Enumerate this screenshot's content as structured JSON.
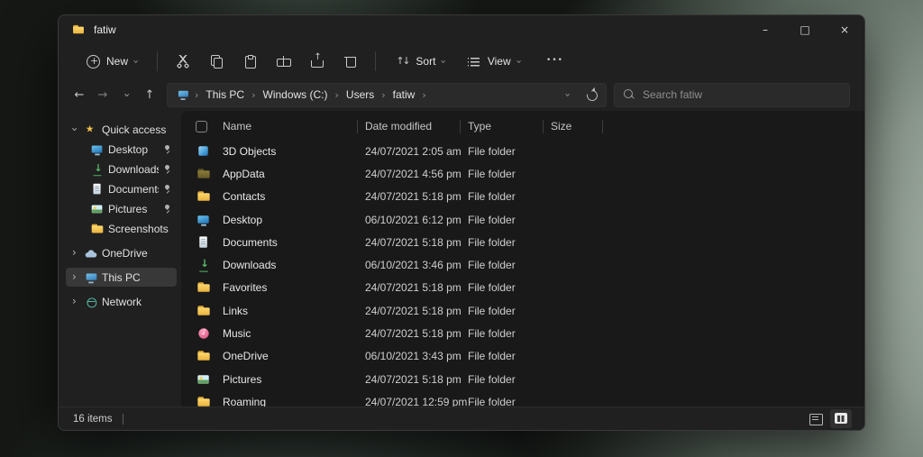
{
  "window": {
    "title": "fatiw",
    "controls": {
      "minimize": "–",
      "maximize": "□",
      "close": "×"
    }
  },
  "toolbar": {
    "new_label": "New",
    "sort_label": "Sort",
    "view_label": "View",
    "actions": [
      {
        "icon": "cut"
      },
      {
        "icon": "copy"
      },
      {
        "icon": "paste"
      },
      {
        "icon": "rename"
      },
      {
        "icon": "share"
      },
      {
        "icon": "delete"
      }
    ]
  },
  "address": {
    "breadcrumbs": [
      {
        "label": "This PC"
      },
      {
        "label": "Windows (C:)"
      },
      {
        "label": "Users"
      },
      {
        "label": "fatiw"
      }
    ],
    "search_placeholder": "Search fatiw"
  },
  "sidebar": {
    "items": [
      {
        "label": "Quick access",
        "icon": "star",
        "chevron": "chev-down",
        "root": true
      },
      {
        "label": "Desktop",
        "icon": "desktop",
        "child": true,
        "pinned": true
      },
      {
        "label": "Downloads",
        "icon": "downloads",
        "child": true,
        "pinned": true
      },
      {
        "label": "Documents",
        "icon": "documents",
        "child": true,
        "pinned": true
      },
      {
        "label": "Pictures",
        "icon": "pictures",
        "child": true,
        "pinned": true
      },
      {
        "label": "Screenshots",
        "icon": "folder",
        "child": true
      },
      {
        "label": "OneDrive",
        "icon": "cloud",
        "chevron": "chev-right",
        "root": true
      },
      {
        "label": "This PC",
        "icon": "pc",
        "chevron": "chev-right",
        "root": true,
        "selected": true
      },
      {
        "label": "Network",
        "icon": "network",
        "chevron": "chev-right",
        "root": true
      }
    ]
  },
  "list": {
    "columns": [
      {
        "label": "Name"
      },
      {
        "label": "Date modified"
      },
      {
        "label": "Type"
      },
      {
        "label": "Size"
      }
    ],
    "rows": [
      {
        "name": "3D Objects",
        "icon": "cube",
        "date": "24/07/2021 2:05 am",
        "type": "File folder",
        "size": ""
      },
      {
        "name": "AppData",
        "icon": "folder-dim",
        "date": "24/07/2021 4:56 pm",
        "type": "File folder",
        "size": ""
      },
      {
        "name": "Contacts",
        "icon": "folder",
        "date": "24/07/2021 5:18 pm",
        "type": "File folder",
        "size": ""
      },
      {
        "name": "Desktop",
        "icon": "desktop",
        "date": "06/10/2021 6:12 pm",
        "type": "File folder",
        "size": ""
      },
      {
        "name": "Documents",
        "icon": "documents",
        "date": "24/07/2021 5:18 pm",
        "type": "File folder",
        "size": ""
      },
      {
        "name": "Downloads",
        "icon": "downloads",
        "date": "06/10/2021 3:46 pm",
        "type": "File folder",
        "size": ""
      },
      {
        "name": "Favorites",
        "icon": "folder",
        "date": "24/07/2021 5:18 pm",
        "type": "File folder",
        "size": ""
      },
      {
        "name": "Links",
        "icon": "folder",
        "date": "24/07/2021 5:18 pm",
        "type": "File folder",
        "size": ""
      },
      {
        "name": "Music",
        "icon": "music",
        "date": "24/07/2021 5:18 pm",
        "type": "File folder",
        "size": ""
      },
      {
        "name": "OneDrive",
        "icon": "folder",
        "date": "06/10/2021 3:43 pm",
        "type": "File folder",
        "size": ""
      },
      {
        "name": "Pictures",
        "icon": "pictures",
        "date": "24/07/2021 5:18 pm",
        "type": "File folder",
        "size": ""
      },
      {
        "name": "Roaming",
        "icon": "folder",
        "date": "24/07/2021 12:59 pm",
        "type": "File folder",
        "size": ""
      }
    ]
  },
  "status": {
    "count": "16 items"
  },
  "colors": {
    "window_bg": "#202020",
    "pane_bg": "#191919",
    "selection_bg": "#383838",
    "folder_yellow": "#f2bd42",
    "accent_green": "#58bd68"
  }
}
